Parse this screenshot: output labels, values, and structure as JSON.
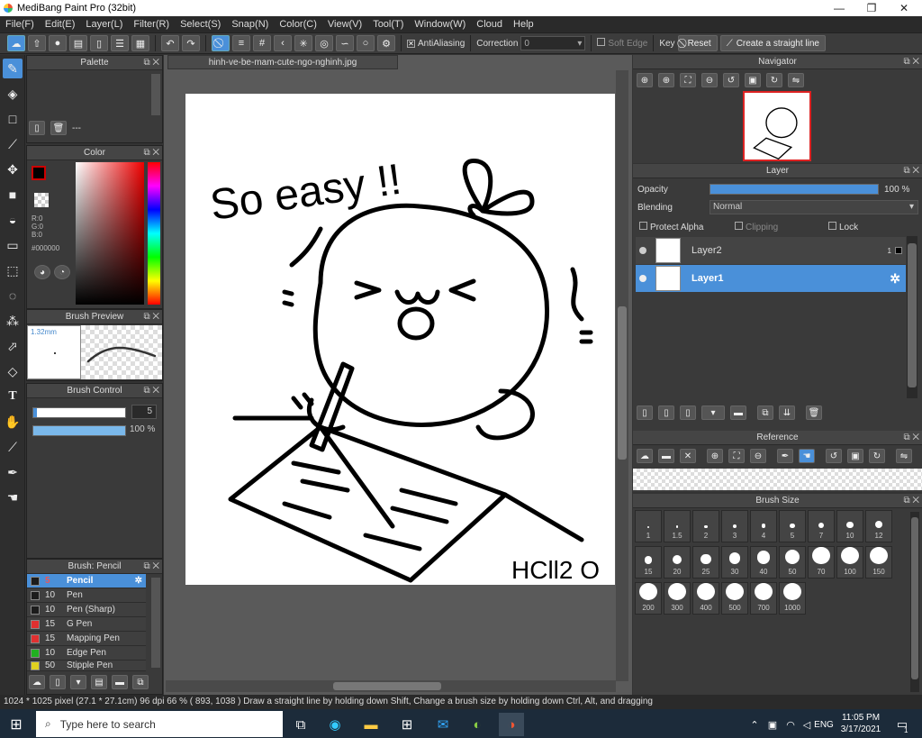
{
  "window": {
    "title": "MediBang Paint Pro (32bit)",
    "minimize": "—",
    "maximize": "❐",
    "close": "✕"
  },
  "menu": [
    "File(F)",
    "Edit(E)",
    "Layer(L)",
    "Filter(R)",
    "Select(S)",
    "Snap(N)",
    "Color(C)",
    "View(V)",
    "Tool(T)",
    "Window(W)",
    "Cloud",
    "Help"
  ],
  "toolbar": {
    "antialiasing": "AntiAliasing",
    "correction_label": "Correction",
    "correction_value": "0",
    "soft_edge": "Soft Edge",
    "key_label": "Key",
    "reset_label": "Reset",
    "straight_line_label": "Create a straight line"
  },
  "document": {
    "tab": "hinh-ve-be-mam-cute-ngo-nghinh.jpg",
    "drawing_text_1": "So easy !!",
    "drawing_text_2": "HCll2 O"
  },
  "palette": {
    "title": "Palette",
    "value": "---"
  },
  "color": {
    "title": "Color",
    "r": "R:0",
    "g": "G:0",
    "b": "B:0",
    "hex": "#000000",
    "primary": "#000000"
  },
  "brush_preview": {
    "title": "Brush Preview",
    "size": "1.32mm"
  },
  "brush_control": {
    "title": "Brush Control",
    "size_value": "5",
    "opacity_value": "100 %",
    "size_fill": 0.04,
    "opacity_fill": 1.0
  },
  "brush_list": {
    "title": "Brush: Pencil",
    "items": [
      {
        "size": "5",
        "name": "Pencil",
        "color": "#1c1c1c",
        "selected": true
      },
      {
        "size": "10",
        "name": "Pen",
        "color": "#1c1c1c",
        "selected": false
      },
      {
        "size": "10",
        "name": "Pen (Sharp)",
        "color": "#1c1c1c",
        "selected": false
      },
      {
        "size": "15",
        "name": "G Pen",
        "color": "#e03030",
        "selected": false
      },
      {
        "size": "15",
        "name": "Mapping Pen",
        "color": "#e03030",
        "selected": false
      },
      {
        "size": "10",
        "name": "Edge Pen",
        "color": "#20b020",
        "selected": false
      },
      {
        "size": "50",
        "name": "Stipple Pen",
        "color": "#e0d020",
        "selected": false
      }
    ]
  },
  "navigator": {
    "title": "Navigator"
  },
  "layer_panel": {
    "title": "Layer",
    "opacity_label": "Opacity",
    "opacity_value": "100 %",
    "opacity_fill": 1.0,
    "blending_label": "Blending",
    "blending_value": "Normal",
    "protect_alpha": "Protect Alpha",
    "clipping": "Clipping",
    "lock": "Lock",
    "layers": [
      {
        "name": "Layer2",
        "badge": "1",
        "selected": false
      },
      {
        "name": "Layer1",
        "selected": true
      }
    ]
  },
  "reference": {
    "title": "Reference"
  },
  "brush_size": {
    "title": "Brush Size",
    "sizes": [
      "1",
      "1.5",
      "2",
      "3",
      "4",
      "5",
      "7",
      "10",
      "12",
      "15",
      "20",
      "25",
      "30",
      "40",
      "50",
      "70",
      "100",
      "150",
      "200",
      "300",
      "400",
      "500",
      "700",
      "1000"
    ]
  },
  "status": {
    "text": "1024 * 1025 pixel   (27.1 * 27.1cm)   96 dpi   66 %   ( 893, 1038 )   Draw a straight line by holding down Shift, Change a brush size by holding down Ctrl, Alt, and dragging"
  },
  "taskbar": {
    "search_placeholder": "Type here to search",
    "lang": "ENG",
    "time": "11:05 PM",
    "date": "3/17/2021",
    "notification_count": "1"
  }
}
